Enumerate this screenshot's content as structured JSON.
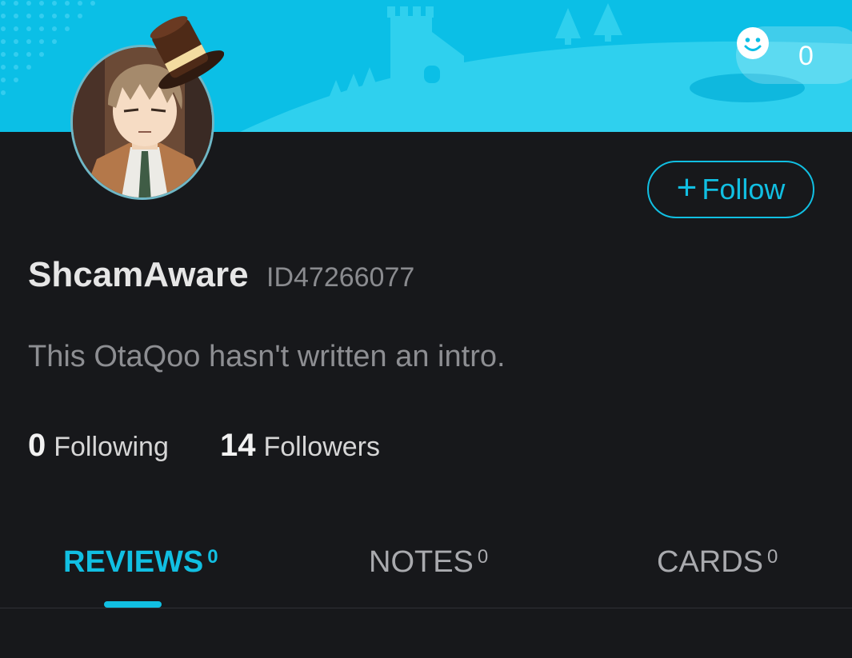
{
  "header": {
    "like_count": "0",
    "colors": {
      "banner": "#0bbfe6",
      "accent": "#11bfe2",
      "background": "#17181b"
    }
  },
  "profile": {
    "username": "ShcamAware",
    "user_id": "ID47266077",
    "intro": "This OtaQoo hasn't written an intro.",
    "follow_label": "Follow",
    "follow_icon": "+"
  },
  "stats": {
    "following_count": "0",
    "following_label": "Following",
    "followers_count": "14",
    "followers_label": "Followers"
  },
  "tabs": [
    {
      "label": "REVIEWS",
      "count": "0",
      "active": true
    },
    {
      "label": "NOTES",
      "count": "0",
      "active": false
    },
    {
      "label": "CARDS",
      "count": "0",
      "active": false
    }
  ]
}
